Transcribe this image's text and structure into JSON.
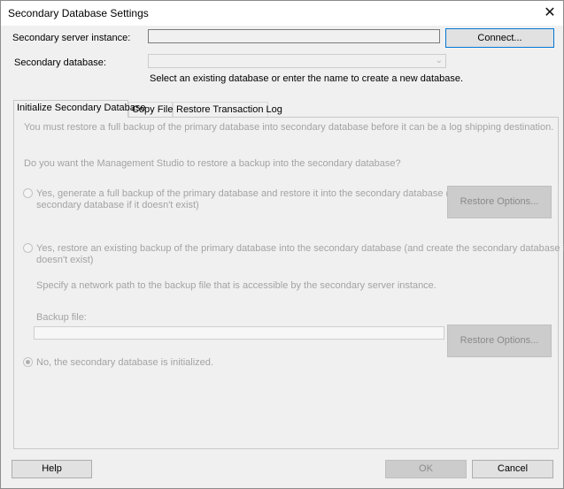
{
  "window": {
    "title": "Secondary Database Settings",
    "close_glyph": "✕"
  },
  "server": {
    "label": "Secondary server instance:",
    "value": "",
    "connect_label": "Connect..."
  },
  "database": {
    "label": "Secondary database:",
    "value": "",
    "hint": "Select an existing database or enter the name to create a new database."
  },
  "tabs": [
    {
      "label": "Initialize Secondary Database",
      "active": true
    },
    {
      "label": "Copy Files",
      "active": false
    },
    {
      "label": "Restore Transaction Log",
      "active": false
    }
  ],
  "initialize": {
    "intro": "You must restore a full backup of the primary database into secondary database before it can be a log shipping destination.",
    "question": "Do you want the Management Studio to restore a backup into the secondary database?",
    "option1_line1": "Yes, generate a full backup of the primary database and restore it into the secondary database (and create the",
    "option1_line2": "secondary database if it doesn't exist)",
    "restore_options_1": "Restore Options...",
    "option2_line1": "Yes, restore an existing backup of the primary database into the secondary database (and create the secondary database if it",
    "option2_line2": "doesn't exist)",
    "network_path_note": "Specify a network path to the backup file that is accessible by the secondary server instance.",
    "backup_file_label": "Backup file:",
    "backup_file_value": "",
    "restore_options_2": "Restore Options...",
    "option3": "No, the secondary database is initialized.",
    "selected_option": 3
  },
  "footer": {
    "help": "Help",
    "ok": "OK",
    "cancel": "Cancel"
  }
}
